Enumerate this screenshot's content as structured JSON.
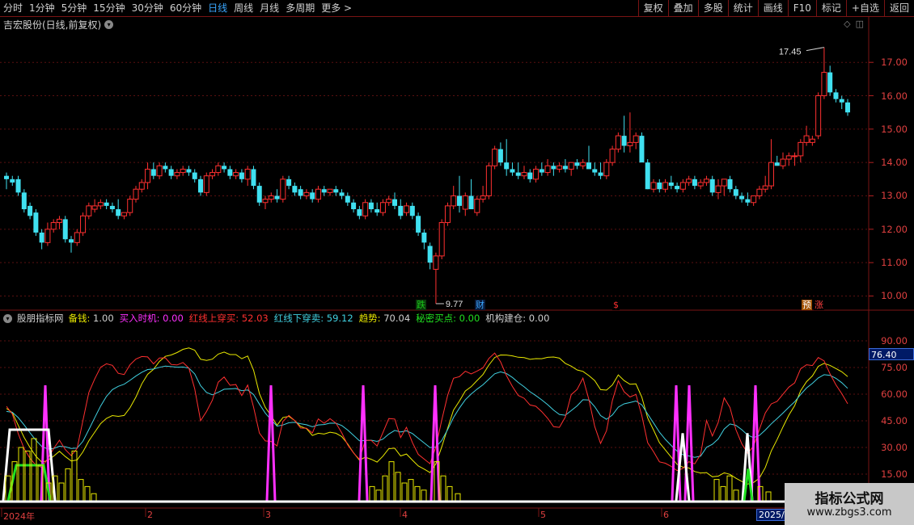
{
  "toolbar": {
    "periods": [
      "分时",
      "1分钟",
      "5分钟",
      "15分钟",
      "30分钟",
      "60分钟",
      "日线",
      "周线",
      "月线",
      "多周期",
      "更多 >"
    ],
    "active_period": "日线",
    "actions": [
      "复权",
      "叠加",
      "多股",
      "统计",
      "画线",
      "F10",
      "标记",
      "+自选",
      "返回"
    ]
  },
  "header": {
    "title": "吉宏股份(日线,前复权)"
  },
  "price_axis": {
    "labels": [
      "17.00",
      "16.00",
      "15.00",
      "14.00",
      "13.00",
      "12.00",
      "11.00",
      "10.00"
    ],
    "values": [
      17,
      16,
      15,
      14,
      13,
      12,
      11,
      10
    ]
  },
  "annotations": {
    "high": "17.45",
    "low": "9.77"
  },
  "badges": [
    {
      "text": "跌",
      "color": "#19c619",
      "bg": "#0a3a0a"
    },
    {
      "text": "财",
      "color": "#3aa7ff",
      "bg": "#0a1a3a"
    },
    {
      "text": "$",
      "color": "#ff3030",
      "bg": "#000"
    },
    {
      "text": "预",
      "color": "#ffffff",
      "bg": "#a05000"
    },
    {
      "text": "涨",
      "color": "#ff4040",
      "bg": "#000"
    }
  ],
  "indicator": {
    "name": "股朋指标网",
    "items": [
      {
        "label": "备钱:",
        "value": "1.00",
        "color": "#e8e800"
      },
      {
        "label": "买入时机:",
        "value": "0.00",
        "color": "#ff30ff"
      },
      {
        "label": "红线上穿买:",
        "value": "52.03",
        "color": "#ff3030"
      },
      {
        "label": "红线下穿卖:",
        "value": "59.12",
        "color": "#40d0e0"
      },
      {
        "label": "趋势:",
        "value": "70.04",
        "color": "#e8e800"
      },
      {
        "label": "秘密买点:",
        "value": "0.00",
        "color": "#20e020"
      },
      {
        "label": "机构建仓:",
        "value": "0.00",
        "color": "#ffffff"
      }
    ],
    "axis_labels": [
      "90.00",
      "75.00",
      "60.00",
      "45.00",
      "30.00",
      "15.00"
    ],
    "current_value": "76.40"
  },
  "x_axis": {
    "labels": [
      "2024年",
      "2",
      "3",
      "4",
      "5",
      "6"
    ],
    "current_date": "2025/0"
  },
  "watermark": {
    "title": "指标公式网",
    "url": "www.zbgs3.com"
  },
  "chart_data": {
    "type": "candlestick",
    "y_range": [
      9.6,
      17.9
    ],
    "candles": [
      [
        13.6,
        13.7,
        13.2,
        13.5
      ],
      [
        13.5,
        13.6,
        13.3,
        13.4
      ],
      [
        13.5,
        13.6,
        13.0,
        13.1
      ],
      [
        13.1,
        13.2,
        12.5,
        12.6
      ],
      [
        12.7,
        12.8,
        12.3,
        12.4
      ],
      [
        12.5,
        12.6,
        11.8,
        11.9
      ],
      [
        11.9,
        12.0,
        11.4,
        11.6
      ],
      [
        11.6,
        12.2,
        11.5,
        12.0
      ],
      [
        12.0,
        12.3,
        11.9,
        12.2
      ],
      [
        12.2,
        12.4,
        12.0,
        12.3
      ],
      [
        12.3,
        12.4,
        11.6,
        11.7
      ],
      [
        11.7,
        11.8,
        11.3,
        11.6
      ],
      [
        11.6,
        12.0,
        11.5,
        11.9
      ],
      [
        11.9,
        12.5,
        11.8,
        12.4
      ],
      [
        12.4,
        12.8,
        12.3,
        12.7
      ],
      [
        12.6,
        12.9,
        12.5,
        12.7
      ],
      [
        12.7,
        12.9,
        12.6,
        12.8
      ],
      [
        12.8,
        12.9,
        12.6,
        12.7
      ],
      [
        12.7,
        12.8,
        12.5,
        12.6
      ],
      [
        12.6,
        12.9,
        12.3,
        12.4
      ],
      [
        12.4,
        12.5,
        12.3,
        12.5
      ],
      [
        12.5,
        13.0,
        12.4,
        12.9
      ],
      [
        12.9,
        13.3,
        12.8,
        13.2
      ],
      [
        13.2,
        13.5,
        13.1,
        13.4
      ],
      [
        13.4,
        14.0,
        13.2,
        13.8
      ],
      [
        13.8,
        14.0,
        13.5,
        13.6
      ],
      [
        13.6,
        14.0,
        13.5,
        13.9
      ],
      [
        13.9,
        14.0,
        13.7,
        13.8
      ],
      [
        13.8,
        13.9,
        13.5,
        13.6
      ],
      [
        13.6,
        13.8,
        13.5,
        13.7
      ],
      [
        13.7,
        13.9,
        13.6,
        13.8
      ],
      [
        13.8,
        13.9,
        13.6,
        13.7
      ],
      [
        13.7,
        13.8,
        13.4,
        13.5
      ],
      [
        13.5,
        13.6,
        13.0,
        13.1
      ],
      [
        13.1,
        13.7,
        13.0,
        13.6
      ],
      [
        13.6,
        13.8,
        13.5,
        13.7
      ],
      [
        13.7,
        14.0,
        13.6,
        13.9
      ],
      [
        13.9,
        14.0,
        13.7,
        13.8
      ],
      [
        13.8,
        13.9,
        13.5,
        13.6
      ],
      [
        13.6,
        13.8,
        13.5,
        13.7
      ],
      [
        13.7,
        13.8,
        13.4,
        13.5
      ],
      [
        13.5,
        13.9,
        13.3,
        13.8
      ],
      [
        13.8,
        13.9,
        13.2,
        13.3
      ],
      [
        13.3,
        13.4,
        12.7,
        12.8
      ],
      [
        12.8,
        13.0,
        12.6,
        12.9
      ],
      [
        12.9,
        13.1,
        12.8,
        13.0
      ],
      [
        13.0,
        13.2,
        12.8,
        12.9
      ],
      [
        12.9,
        13.6,
        12.8,
        13.5
      ],
      [
        13.5,
        13.6,
        13.2,
        13.3
      ],
      [
        13.3,
        13.4,
        13.0,
        13.1
      ],
      [
        13.2,
        13.3,
        12.9,
        13.0
      ],
      [
        13.0,
        13.2,
        12.9,
        13.1
      ],
      [
        13.1,
        13.2,
        12.8,
        12.9
      ],
      [
        12.9,
        13.3,
        12.8,
        13.2
      ],
      [
        13.2,
        13.3,
        13.0,
        13.1
      ],
      [
        13.1,
        13.2,
        13.0,
        13.2
      ],
      [
        13.2,
        13.3,
        13.0,
        13.1
      ],
      [
        13.1,
        13.2,
        12.9,
        13.0
      ],
      [
        13.0,
        13.1,
        12.7,
        12.8
      ],
      [
        12.8,
        12.9,
        12.5,
        12.6
      ],
      [
        12.6,
        12.7,
        12.3,
        12.4
      ],
      [
        12.4,
        12.9,
        12.3,
        12.8
      ],
      [
        12.8,
        12.9,
        12.5,
        12.6
      ],
      [
        12.6,
        12.8,
        12.4,
        12.5
      ],
      [
        12.5,
        12.9,
        12.4,
        12.8
      ],
      [
        12.8,
        13.0,
        12.7,
        12.9
      ],
      [
        12.9,
        13.1,
        12.6,
        12.7
      ],
      [
        12.7,
        12.9,
        12.3,
        12.4
      ],
      [
        12.5,
        12.8,
        12.4,
        12.7
      ],
      [
        12.7,
        12.8,
        12.3,
        12.4
      ],
      [
        12.4,
        12.5,
        11.8,
        11.9
      ],
      [
        11.9,
        12.0,
        11.4,
        11.6
      ],
      [
        11.5,
        11.6,
        10.8,
        11.0
      ],
      [
        10.8,
        11.3,
        9.77,
        11.2
      ],
      [
        11.2,
        12.3,
        11.1,
        12.2
      ],
      [
        12.2,
        12.8,
        12.1,
        12.7
      ],
      [
        12.7,
        13.3,
        12.6,
        13.0
      ],
      [
        13.0,
        13.6,
        12.5,
        12.7
      ],
      [
        12.6,
        13.1,
        12.4,
        13.0
      ],
      [
        13.0,
        13.5,
        12.8,
        12.6
      ],
      [
        12.5,
        13.0,
        12.4,
        12.9
      ],
      [
        12.9,
        13.3,
        12.8,
        13.0
      ],
      [
        13.0,
        14.0,
        12.9,
        13.9
      ],
      [
        13.9,
        14.5,
        13.8,
        14.4
      ],
      [
        14.4,
        14.6,
        13.9,
        14.0
      ],
      [
        14.0,
        14.7,
        13.6,
        13.8
      ],
      [
        13.8,
        14.0,
        13.6,
        13.7
      ],
      [
        13.7,
        14.0,
        13.5,
        13.6
      ],
      [
        13.6,
        13.9,
        13.5,
        13.7
      ],
      [
        13.7,
        13.8,
        13.4,
        13.5
      ],
      [
        13.5,
        13.9,
        13.4,
        13.8
      ],
      [
        13.8,
        14.0,
        13.6,
        13.7
      ],
      [
        13.7,
        14.1,
        13.6,
        13.9
      ],
      [
        13.9,
        14.0,
        13.6,
        13.8
      ],
      [
        13.8,
        14.0,
        13.7,
        13.9
      ],
      [
        13.9,
        14.1,
        13.7,
        13.8
      ],
      [
        13.8,
        14.0,
        13.6,
        14.0
      ],
      [
        14.0,
        14.1,
        13.8,
        13.9
      ],
      [
        13.9,
        14.1,
        13.8,
        14.0
      ],
      [
        14.0,
        14.5,
        13.9,
        13.8
      ],
      [
        13.8,
        14.0,
        13.6,
        13.7
      ],
      [
        13.7,
        14.0,
        13.5,
        13.6
      ],
      [
        13.6,
        14.1,
        13.5,
        14.0
      ],
      [
        14.0,
        14.5,
        13.9,
        14.4
      ],
      [
        14.4,
        14.9,
        14.3,
        14.8
      ],
      [
        14.8,
        15.4,
        14.3,
        14.5
      ],
      [
        14.5,
        15.5,
        14.3,
        14.6
      ],
      [
        14.6,
        14.9,
        14.4,
        14.8
      ],
      [
        14.8,
        14.9,
        14.1,
        14.0
      ],
      [
        14.0,
        14.1,
        13.2,
        13.2
      ],
      [
        13.2,
        13.5,
        13.1,
        13.4
      ],
      [
        13.4,
        13.5,
        13.1,
        13.2
      ],
      [
        13.2,
        13.5,
        13.1,
        13.4
      ],
      [
        13.4,
        13.6,
        13.2,
        13.3
      ],
      [
        13.3,
        13.4,
        13.1,
        13.2
      ],
      [
        13.2,
        13.5,
        13.1,
        13.4
      ],
      [
        13.4,
        13.6,
        13.3,
        13.5
      ],
      [
        13.5,
        13.6,
        13.2,
        13.3
      ],
      [
        13.3,
        13.5,
        13.2,
        13.4
      ],
      [
        13.4,
        13.6,
        13.3,
        13.5
      ],
      [
        13.5,
        13.6,
        13.0,
        13.1
      ],
      [
        13.1,
        13.5,
        12.9,
        13.3
      ],
      [
        13.3,
        13.5,
        13.0,
        13.5
      ],
      [
        13.5,
        13.6,
        13.1,
        13.2
      ],
      [
        13.2,
        13.3,
        12.9,
        13.0
      ],
      [
        13.0,
        13.1,
        12.8,
        12.9
      ],
      [
        12.9,
        13.1,
        12.7,
        12.8
      ],
      [
        12.8,
        13.0,
        12.7,
        13.0
      ],
      [
        13.0,
        13.3,
        12.9,
        13.2
      ],
      [
        13.2,
        13.6,
        13.1,
        13.3
      ],
      [
        13.3,
        14.7,
        13.2,
        14.0
      ],
      [
        14.0,
        14.2,
        13.9,
        13.9
      ],
      [
        13.9,
        14.3,
        13.8,
        14.1
      ],
      [
        14.1,
        14.3,
        13.9,
        14.2
      ],
      [
        14.2,
        14.3,
        13.9,
        14.2
      ],
      [
        14.2,
        14.7,
        14.0,
        14.6
      ],
      [
        14.6,
        15.1,
        14.5,
        14.8
      ],
      [
        14.6,
        14.8,
        14.5,
        14.7
      ],
      [
        14.8,
        16.1,
        14.7,
        16.0
      ],
      [
        16.0,
        17.45,
        15.9,
        16.7
      ],
      [
        16.7,
        16.9,
        16.0,
        16.1
      ],
      [
        16.1,
        16.2,
        15.8,
        15.9
      ],
      [
        15.9,
        16.0,
        15.6,
        15.8
      ],
      [
        15.8,
        15.9,
        15.4,
        15.5
      ]
    ],
    "oscillator": {
      "axis_range": [
        0,
        100
      ],
      "series": [
        "红线上穿买",
        "红线下穿卖",
        "趋势",
        "买入时机",
        "秘密买点",
        "机构建仓",
        "备钱"
      ]
    }
  }
}
